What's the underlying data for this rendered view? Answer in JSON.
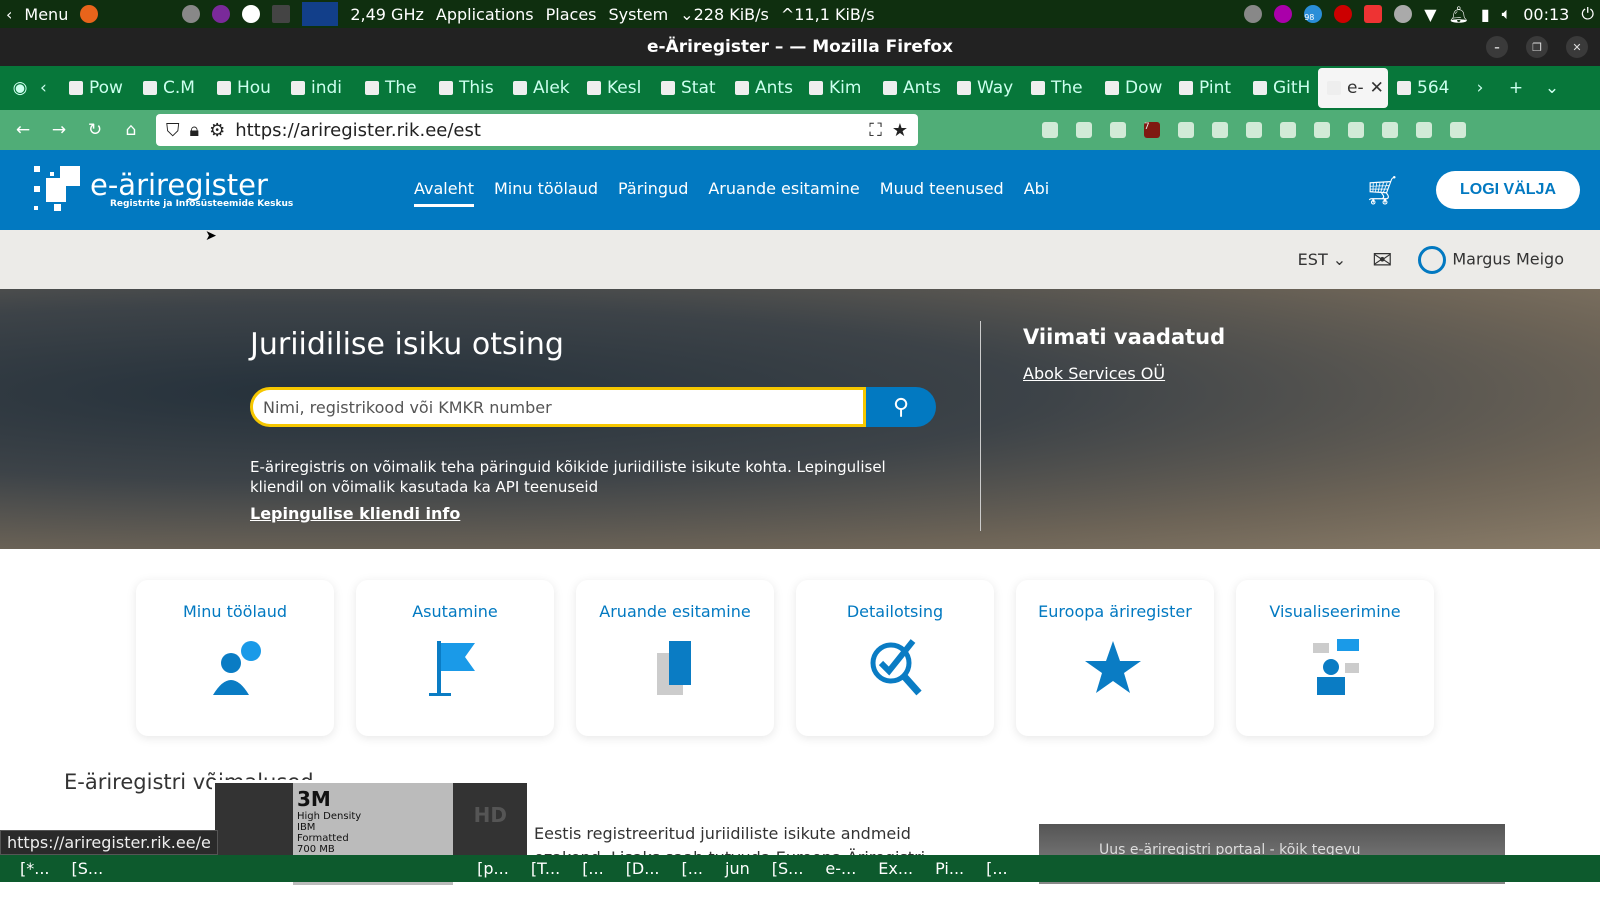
{
  "system_panel": {
    "menu": "Menu",
    "cpu": "2,49 GHz",
    "applications": "Applications",
    "places": "Places",
    "system": "System",
    "net_down": "228 KiB/s",
    "net_up": "11,1 KiB/s",
    "clock": "00:13",
    "badge": "98"
  },
  "window": {
    "title": "e-Äriregister – — Mozilla Firefox"
  },
  "tabs": [
    "Pow",
    "C.M",
    "Hou",
    "indi",
    "The",
    "This",
    "Alek",
    "Kesl",
    "Stat",
    "Ants",
    "Kim",
    "Ants",
    "Way",
    "The",
    "Dow",
    "Pint",
    "GitH",
    "e-",
    "564"
  ],
  "address": {
    "url": "https://ariregister.rik.ee/est",
    "ublock_count": "7"
  },
  "header": {
    "logo_title": "e-äriregister",
    "logo_subtitle": "Registrite ja Infosüsteemide Keskus",
    "nav": [
      "Avaleht",
      "Minu töölaud",
      "Päringud",
      "Aruande esitamine",
      "Muud teenused",
      "Abi"
    ],
    "logout": "LOGI VÄLJA"
  },
  "subbar": {
    "language": "EST",
    "user": "Margus Meigo"
  },
  "hero": {
    "title": "Juriidilise isiku otsing",
    "search_placeholder": "Nimi, registrikood või KMKR number",
    "description": "E-äriregistris on võimalik teha päringuid kõikide juriidiliste isikute kohta. Lepingulisel kliendil on võimalik kasutada ka API teenuseid",
    "link": "Lepingulise kliendi info",
    "recent_title": "Viimati vaadatud",
    "recent_item": "Abok Services OÜ"
  },
  "cards": [
    "Minu töölaud",
    "Asutamine",
    "Aruande esitamine",
    "Detailotsing",
    "Euroopa äriregister",
    "Visualiseerimine"
  ],
  "section": {
    "title": "E-äriregistri võimalused",
    "text1": "Eestis registreeritud juriidiliste isikute andmeid",
    "text2": "ezakond. Lisaks saab tutvuda Euroopa Äriregistri",
    "video_title": "Uus e-äriregistri portaal - kõik tegevu"
  },
  "floppy": {
    "brand": "3M",
    "line1": "High Density",
    "line2": "IBM",
    "line3": "Formatted",
    "line4": "700 MB",
    "hd": "HD"
  },
  "status_url": "https://ariregister.rik.ee/e",
  "taskbar": [
    "[*...",
    "[S...",
    "",
    "[p...",
    "[T...",
    "[...",
    "[D...",
    "[...",
    "jun",
    "[S...",
    "e-...",
    "Ex...",
    "Pi...",
    "[..."
  ]
}
